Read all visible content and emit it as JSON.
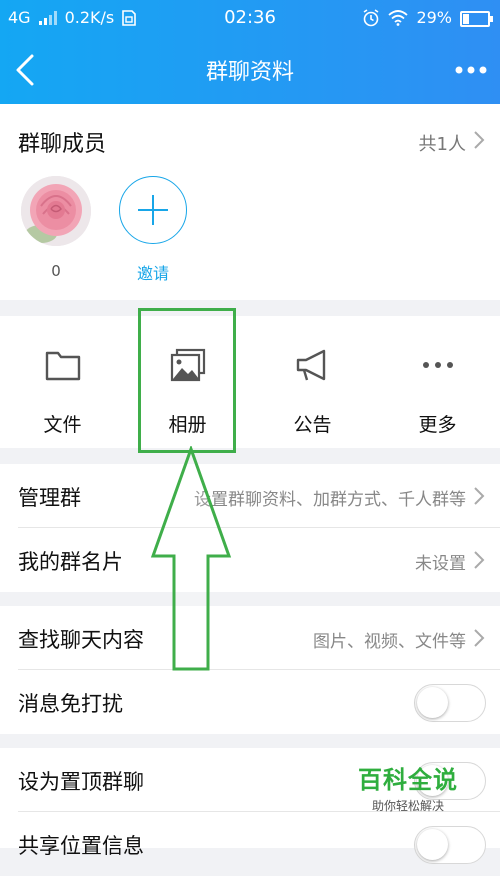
{
  "status_bar": {
    "network": "4G",
    "speed": "0.2K/s",
    "time": "02:36",
    "battery": "29%"
  },
  "nav": {
    "title": "群聊资料"
  },
  "members": {
    "label": "群聊成员",
    "count": "共1人",
    "member_name": "0",
    "invite_label": "邀请"
  },
  "actions": [
    {
      "label": "文件",
      "icon": "folder-icon"
    },
    {
      "label": "相册",
      "icon": "album-icon"
    },
    {
      "label": "公告",
      "icon": "megaphone-icon"
    },
    {
      "label": "更多",
      "icon": "more-dots-icon"
    }
  ],
  "list": {
    "manage": {
      "title": "管理群",
      "value": "设置群聊资料、加群方式、千人群等"
    },
    "card": {
      "title": "我的群名片",
      "value": "未设置"
    },
    "search": {
      "title": "查找聊天内容",
      "value": "图片、视频、文件等"
    },
    "mute": {
      "title": "消息免打扰",
      "on": false
    },
    "pin": {
      "title": "设为置顶群聊",
      "on": false
    },
    "location": {
      "title": "共享位置信息"
    }
  },
  "watermark": {
    "title": "百科全说",
    "subtitle": "助你轻松解决"
  },
  "colors": {
    "header_start": "#14a7f3",
    "header_end": "#2f8ff3",
    "accent": "#18a6e8",
    "highlight_green": "#3fae4a"
  }
}
